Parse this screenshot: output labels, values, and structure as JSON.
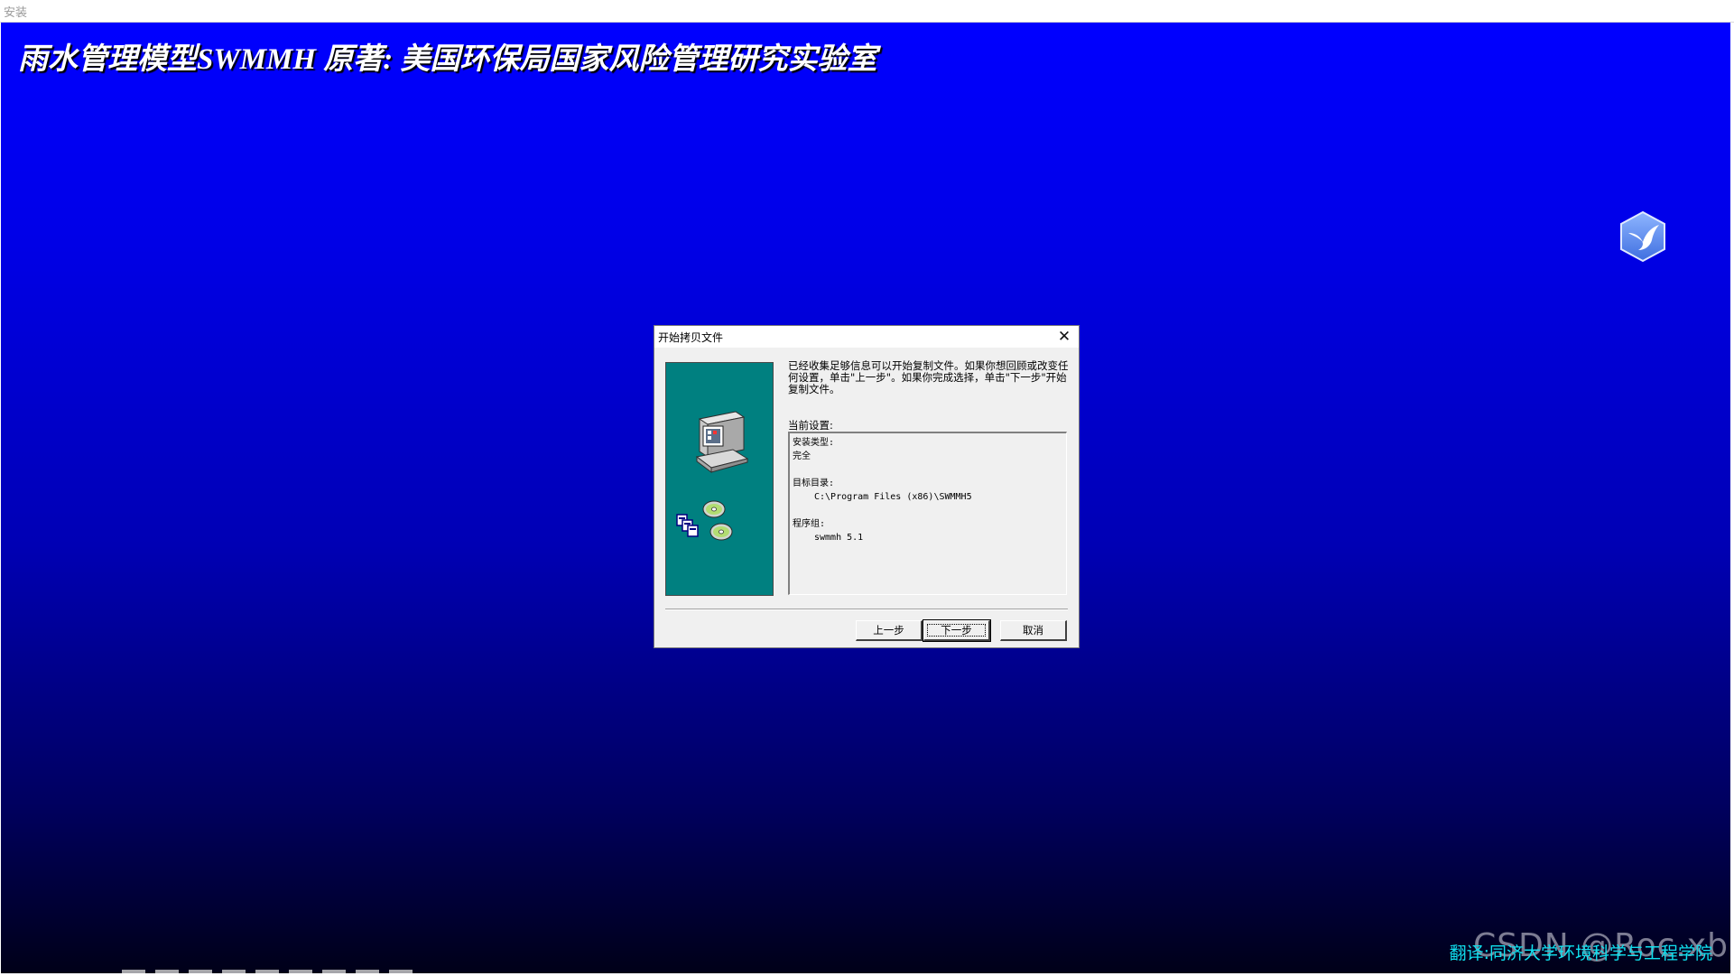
{
  "window": {
    "title": "安装"
  },
  "banner": {
    "text": "雨水管理模型SWMMH  原著: 美国环保局国家风险管理研究实验室"
  },
  "watermarks": {
    "translation_credit": "翻译:同济大学环境科学与工程学院",
    "csdn": "CSDN @Roc.xb"
  },
  "dialog": {
    "title": "开始拷贝文件",
    "close_icon": "close-icon",
    "intro": "已经收集足够信息可以开始复制文件。如果你想回顾或改变任何设置，单击\"上一步\"。如果你完成选择，单击\"下一步\"开始复制文件。",
    "current_settings_label": "当前设置:",
    "settings": {
      "setup_type_label": "安装类型:",
      "setup_type_value": "完全",
      "target_dir_label": "目标目录:",
      "target_dir_value": "C:\\Program Files (x86)\\SWMMH5",
      "program_group_label": "程序组:",
      "program_group_value": "swmmh 5.1"
    },
    "buttons": {
      "back": "上一步",
      "next": "下一步",
      "cancel": "取消"
    },
    "side_panel_color": "#008080",
    "illustration": "computer-with-discs-icon"
  },
  "colors": {
    "background_top": "#0000ff",
    "background_bottom": "#000018",
    "translation_credit": "#10e0ee"
  }
}
